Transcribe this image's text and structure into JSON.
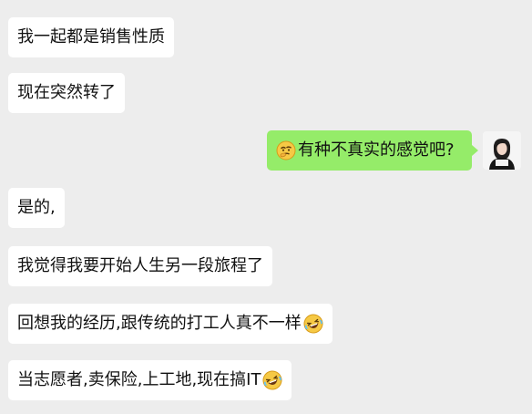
{
  "messages": [
    {
      "side": "left",
      "text": "我一起都是销售性质",
      "emoji": ""
    },
    {
      "side": "left",
      "text": "现在突然转了",
      "emoji": ""
    },
    {
      "side": "right",
      "text": "有种不真实的感觉吧?",
      "emoji": "thinking-face-icon"
    },
    {
      "side": "left",
      "text": "是的,",
      "emoji": ""
    },
    {
      "side": "left",
      "text": "我觉得我要开始人生另一段旅程了",
      "emoji": ""
    },
    {
      "side": "left",
      "text": "回想我的经历,跟传统的打工人真不一样",
      "emoji": "rolling-laughing-icon"
    },
    {
      "side": "left",
      "text": "当志愿者,卖保险,上工地,现在搞IT",
      "emoji": "rolling-laughing-icon"
    }
  ],
  "colors": {
    "background": "#ededed",
    "incoming_bubble": "#ffffff",
    "outgoing_bubble": "#95ec69",
    "text": "#111111"
  }
}
